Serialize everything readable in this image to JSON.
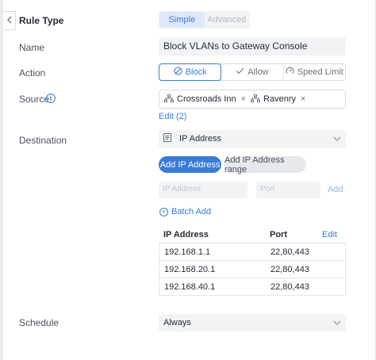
{
  "form": {
    "rule_type": {
      "label": "Rule Type",
      "options": [
        "Simple",
        "Advanced"
      ],
      "selected": "Simple"
    },
    "name": {
      "label": "Name",
      "value": "Block VLANs to Gateway Console"
    },
    "action": {
      "label": "Action",
      "options": [
        {
          "label": "Block",
          "icon": "block-icon"
        },
        {
          "label": "Allow",
          "icon": "check-icon"
        },
        {
          "label": "Speed Limit",
          "icon": "speedometer-icon"
        }
      ],
      "selected": "Block"
    },
    "source": {
      "label": "Source",
      "chips": [
        {
          "label": "Crossroads Inn",
          "icon": "network-icon"
        },
        {
          "label": "Ravenry",
          "icon": "network-icon"
        }
      ],
      "edit_link": "Edit (2)"
    },
    "destination": {
      "label": "Destination",
      "type_select": "IP Address",
      "tabs": [
        "Add IP Address",
        "Add IP Address range"
      ],
      "ip_placeholder": "IP Address",
      "port_placeholder": "Port",
      "add_link": "Add",
      "batch_add": "Batch Add",
      "table": {
        "headers": [
          "IP Address",
          "Port"
        ],
        "edit_link": "Edit",
        "rows": [
          {
            "ip": "192.168.1.1",
            "port": "22,80,443"
          },
          {
            "ip": "192.168.20.1",
            "port": "22,80,443"
          },
          {
            "ip": "192.168.40.1",
            "port": "22,80,443"
          }
        ]
      }
    },
    "schedule": {
      "label": "Schedule",
      "value": "Always"
    }
  },
  "colors": {
    "accent": "#3a7bd5",
    "field_bg": "#f1f3f5"
  }
}
